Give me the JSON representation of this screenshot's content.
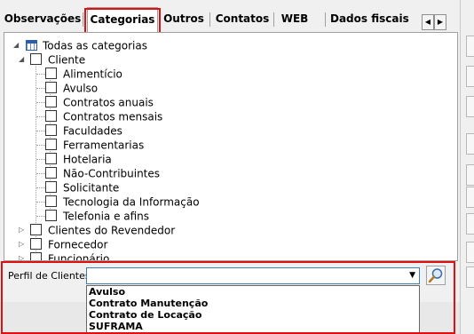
{
  "tabs": [
    {
      "label": "Observações"
    },
    {
      "label": "Categorias"
    },
    {
      "label": "Outros"
    },
    {
      "label": "Contatos"
    },
    {
      "label": "WEB"
    },
    {
      "label": "Dados fiscais"
    }
  ],
  "active_tab": "Categorias",
  "tree": {
    "root": "Todas as categorias",
    "cliente": "Cliente",
    "children": [
      "Alimentício",
      "Avulso",
      "Contratos anuais",
      "Contratos mensais",
      "Faculdades",
      "Ferramentarias",
      "Hotelaria",
      "Não-Contribuintes",
      "Solicitante",
      "Tecnologia da Informação",
      "Telefonia e afins"
    ],
    "siblings": [
      "Clientes do Revendedor",
      "Fornecedor",
      "Funcionário"
    ]
  },
  "perfil": {
    "label": "Perfil de Clientes:",
    "value": "",
    "options": [
      "Avulso",
      "Contrato Manutenção",
      "Contrato de Locação",
      "SUFRAMA"
    ]
  },
  "colors": {
    "highlight": "#e01010",
    "combo_border": "#3c7fb1"
  }
}
